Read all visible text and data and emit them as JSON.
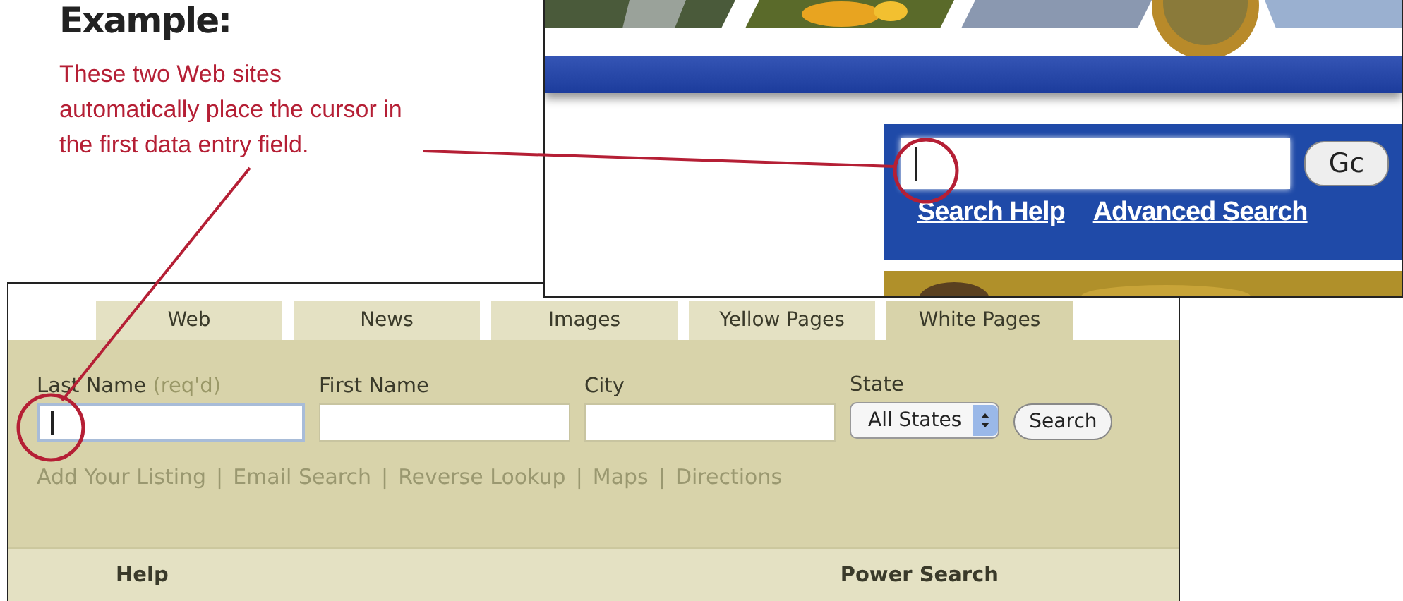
{
  "title": "Example:",
  "caption": "These two Web sites automatically place the cursor in the first data entry field.",
  "site_a": {
    "search": {
      "focused": true
    },
    "go_button": "Gc",
    "links": [
      "Search Help",
      "Advanced Search"
    ]
  },
  "site_b": {
    "tabs": [
      {
        "label": "Web",
        "selected": false
      },
      {
        "label": "News",
        "selected": false
      },
      {
        "label": "Images",
        "selected": false
      },
      {
        "label": "Yellow Pages",
        "selected": false
      },
      {
        "label": "White Pages",
        "selected": true
      }
    ],
    "fields": [
      {
        "label": "Last Name",
        "note": "(req'd)",
        "focused": true
      },
      {
        "label": "First Name",
        "focused": false
      },
      {
        "label": "City",
        "focused": false
      }
    ],
    "state": {
      "label": "State",
      "value": "All States"
    },
    "search_button": "Search",
    "links": [
      "Add Your Listing",
      "Email Search",
      "Reverse Lookup",
      "Maps",
      "Directions"
    ],
    "separator": "|",
    "footer": [
      "Help",
      "Power Search"
    ]
  }
}
